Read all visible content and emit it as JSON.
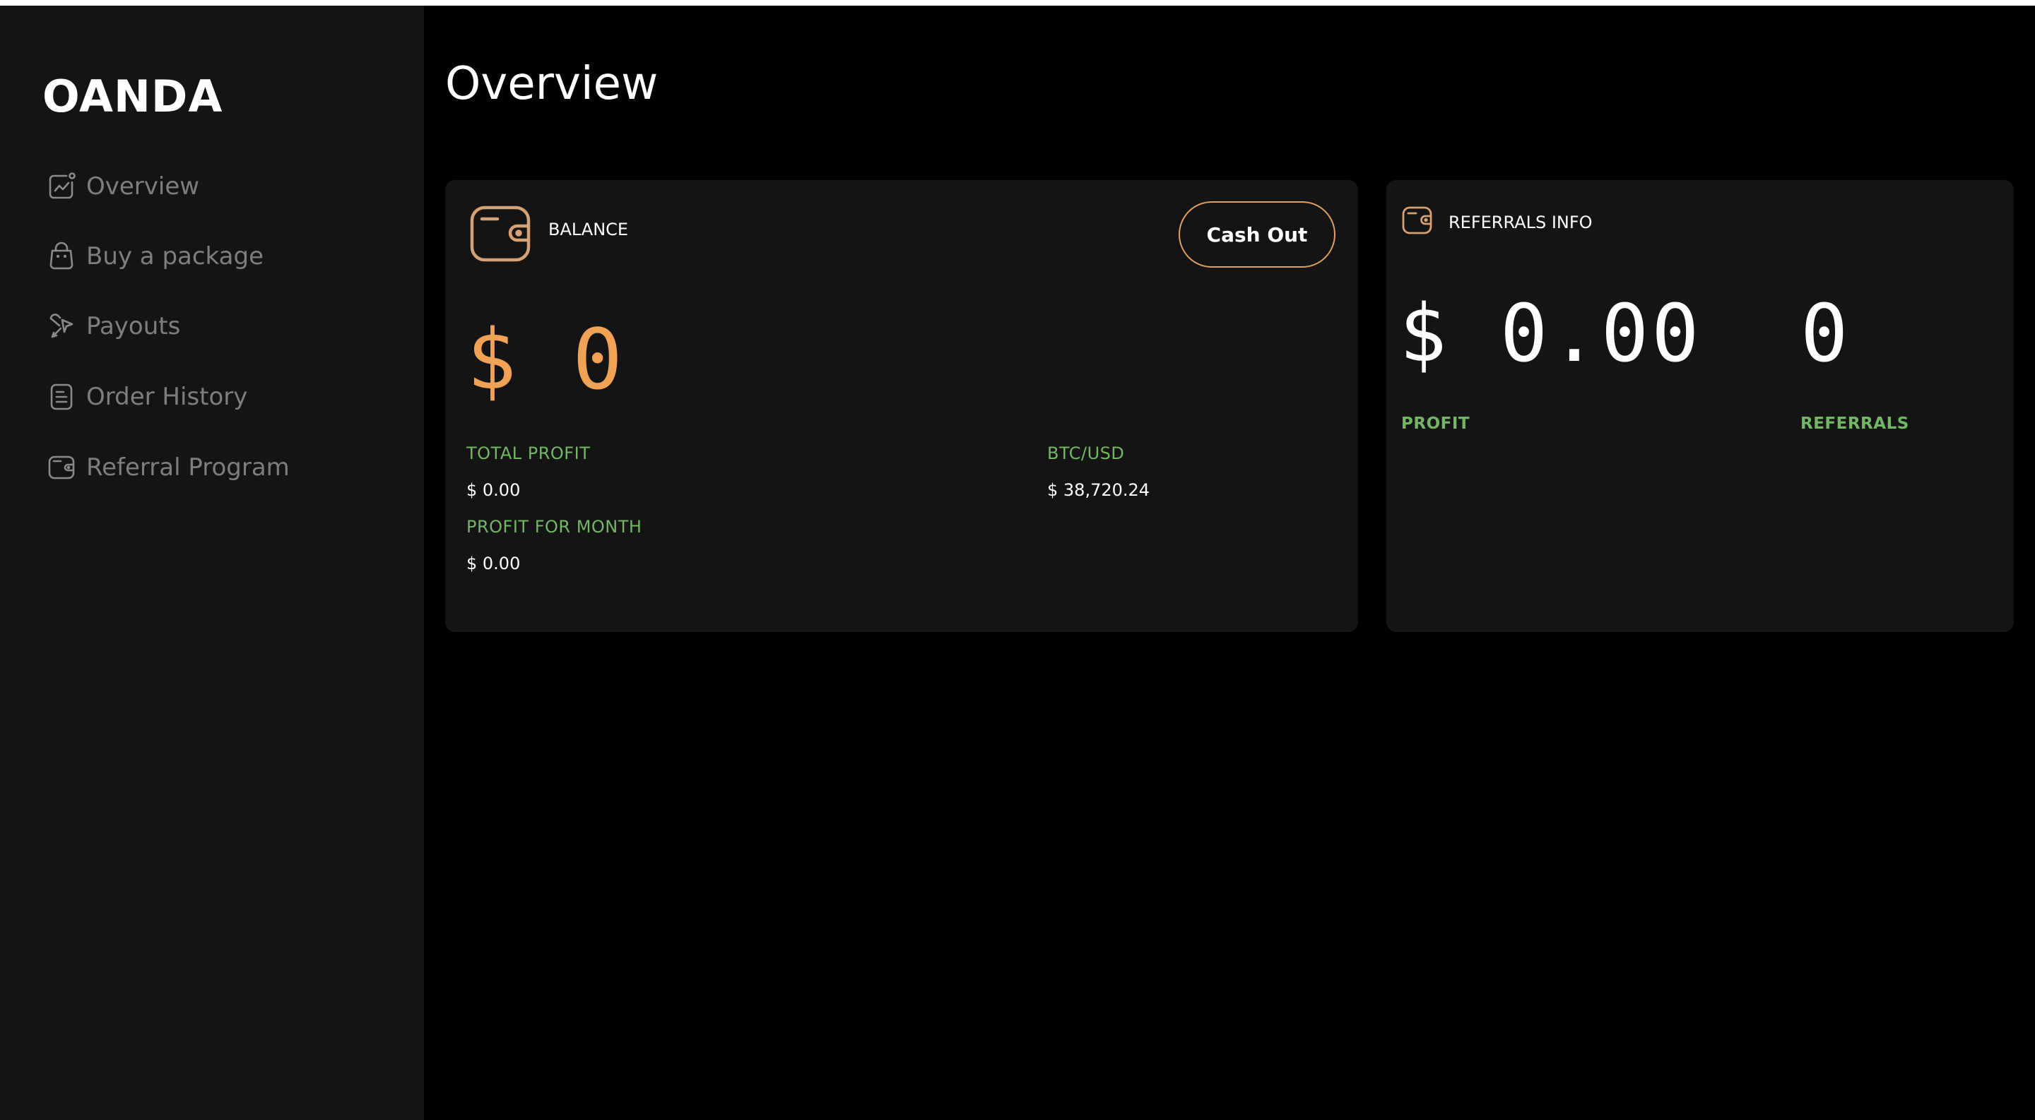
{
  "app": {
    "brand": "OANDA"
  },
  "sidebar": {
    "items": [
      {
        "label": "Overview",
        "icon": "chart-icon"
      },
      {
        "label": "Buy a package",
        "icon": "shopping-bag-icon"
      },
      {
        "label": "Payouts",
        "icon": "payout-icon"
      },
      {
        "label": "Order History",
        "icon": "document-icon"
      },
      {
        "label": "Referral Program",
        "icon": "wallet-icon"
      }
    ]
  },
  "page": {
    "title": "Overview"
  },
  "balance_card": {
    "label": "BALANCE",
    "icon": "wallet-icon",
    "cash_out_label": "Cash Out",
    "amount": "$ 0",
    "total_profit_label": "TOTAL PROFIT",
    "total_profit_value": "$ 0.00",
    "profit_month_label": "PROFIT FOR MONTH",
    "profit_month_value": "$ 0.00",
    "btc_label": "BTC/USD",
    "btc_value": "$ 38,720.24"
  },
  "referrals_card": {
    "label": "REFERRALS INFO",
    "icon": "wallet-icon",
    "profit_amount": "$ 0.00",
    "profit_label": "PROFIT",
    "referrals_count": "0",
    "referrals_label": "REFERRALS"
  },
  "colors": {
    "accent_orange": "#f0a256",
    "icon_tan": "#d4a276",
    "label_green": "#75b566",
    "card_bg": "#141414",
    "page_bg": "#000000"
  }
}
